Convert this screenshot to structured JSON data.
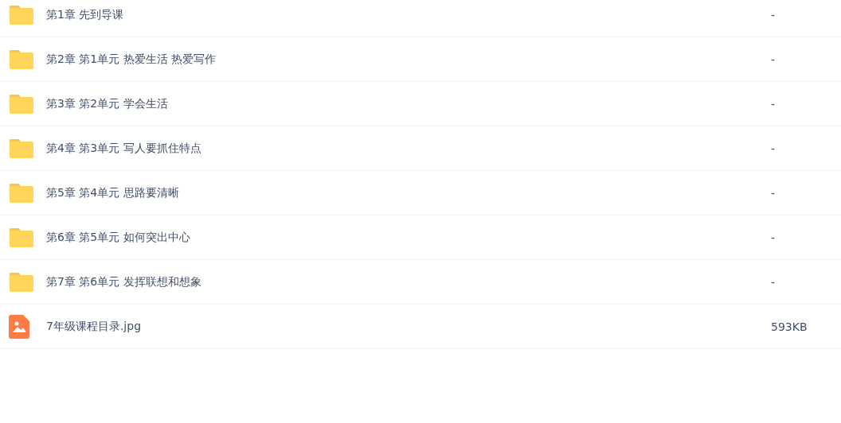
{
  "files": [
    {
      "kind": "folder",
      "name": "第1章 先到导课",
      "size": "-"
    },
    {
      "kind": "folder",
      "name": "第2章 第1单元 热爱生活 热爱写作",
      "size": "-"
    },
    {
      "kind": "folder",
      "name": "第3章 第2单元 学会生活",
      "size": "-"
    },
    {
      "kind": "folder",
      "name": "第4章 第3单元 写人要抓住特点",
      "size": "-"
    },
    {
      "kind": "folder",
      "name": "第5章 第4单元 思路要清晰",
      "size": "-"
    },
    {
      "kind": "folder",
      "name": "第6章 第5单元 如何突出中心",
      "size": "-"
    },
    {
      "kind": "folder",
      "name": "第7章 第6单元 发挥联想和想象",
      "size": "-"
    },
    {
      "kind": "image",
      "name": "7年级课程目录.jpg",
      "size": "593KB"
    }
  ]
}
